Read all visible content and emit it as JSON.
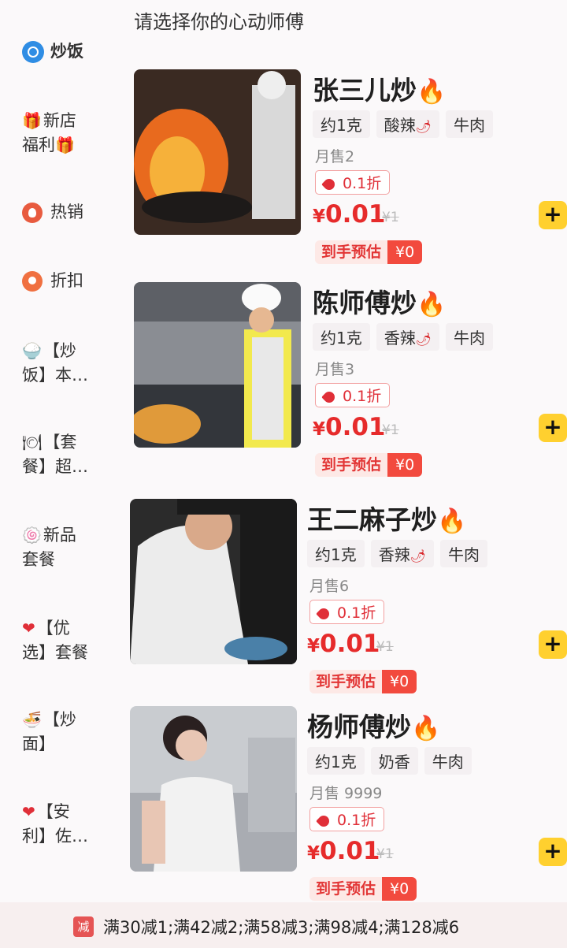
{
  "header": {
    "title": "请选择你的心动师傅"
  },
  "sidebar": {
    "items": [
      {
        "label": "炒饭",
        "icon": "search-icon"
      },
      {
        "label_line1": "新店",
        "label_line2": "福利",
        "icon": "gift-icon"
      },
      {
        "label": "热销",
        "icon": "hot-icon"
      },
      {
        "label": "折扣",
        "icon": "discount-icon"
      },
      {
        "label_line1": "【炒",
        "label_line2": "饭】本…",
        "icon": "rice-bowl-icon"
      },
      {
        "label_line1": "【套",
        "label_line2": "餐】超…",
        "icon": "plate-icon"
      },
      {
        "label_line1": "新品",
        "label_line2": "套餐",
        "icon": "new-plate-icon"
      },
      {
        "label_line1": "【优",
        "label_line2": "选】套餐",
        "icon": "heart-icon"
      },
      {
        "label_line1": "【炒",
        "label_line2": "面】",
        "icon": "noodle-bowl-icon"
      },
      {
        "label_line1": "【安",
        "label_line2": "利】佐…",
        "icon": "heart-icon"
      }
    ]
  },
  "products": [
    {
      "name": "张三儿炒",
      "tags": [
        "约1克",
        "酸辣",
        "牛肉"
      ],
      "monthly": "月售2",
      "discount": "0.1折",
      "price_symbol": "¥",
      "price": "0.01",
      "orig": "¥1",
      "est_label": "到手预估",
      "est_value": "¥0"
    },
    {
      "name": "陈师傅炒",
      "tags": [
        "约1克",
        "香辣",
        "牛肉"
      ],
      "monthly": "月售3",
      "discount": "0.1折",
      "price_symbol": "¥",
      "price": "0.01",
      "orig": "¥1",
      "est_label": "到手预估",
      "est_value": "¥0"
    },
    {
      "name": "王二麻子炒",
      "tags": [
        "约1克",
        "香辣",
        "牛肉"
      ],
      "monthly": "月售6",
      "discount": "0.1折",
      "price_symbol": "¥",
      "price": "0.01",
      "orig": "¥1",
      "est_label": "到手预估",
      "est_value": "¥0"
    },
    {
      "name": "杨师傅炒",
      "tags": [
        "约1克",
        "奶香",
        "牛肉"
      ],
      "monthly": "月售 9999",
      "discount": "0.1折",
      "price_symbol": "¥",
      "price": "0.01",
      "orig": "¥1",
      "est_label": "到手预估",
      "est_value": "¥0"
    }
  ],
  "promo": {
    "badge": "减",
    "text": "满30减1;满42减2;满58减3;满98减4;满128减6"
  },
  "colors": {
    "price_red": "#e62b2b",
    "add_yellow": "#ffd02f",
    "badge_red": "#f24a3e"
  }
}
